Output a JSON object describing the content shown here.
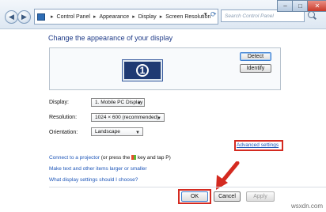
{
  "address_bar": {
    "crumbs": [
      "Control Panel",
      "Appearance",
      "Display",
      "Screen Resolution"
    ],
    "search_placeholder": "Search Control Panel",
    "refresh_glyph": "⟳",
    "dropdown_glyph": "▾"
  },
  "window_controls": {
    "minimize": "–",
    "maximize": "□",
    "close": "✕"
  },
  "page": {
    "title": "Change the appearance of your display"
  },
  "monitor": {
    "number": "1"
  },
  "buttons": {
    "detect": "Detect",
    "identify": "Identify",
    "ok": "OK",
    "cancel": "Cancel",
    "apply": "Apply"
  },
  "settings": {
    "display_label": "Display:",
    "display_value": "1. Mobile PC Display",
    "resolution_label": "Resolution:",
    "resolution_value": "1024 × 600 (recommended)",
    "orientation_label": "Orientation:",
    "orientation_value": "Landscape"
  },
  "links": {
    "advanced": "Advanced settings",
    "projector_link": "Connect to a projector",
    "projector_text": "(or press the",
    "projector_text2": "key and tap P)",
    "text_size": "Make text and other items larger or smaller",
    "which_settings": "What display settings should I choose?"
  },
  "watermark": "wsxdn.com",
  "colors": {
    "highlight": "#d42a20",
    "link": "#1e56b8",
    "title": "#1e3a87"
  }
}
